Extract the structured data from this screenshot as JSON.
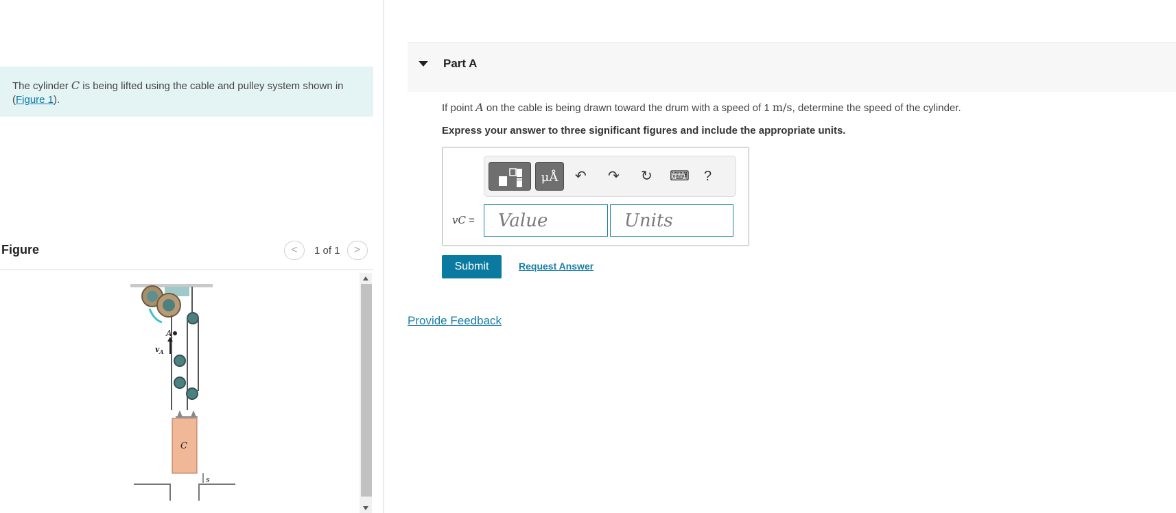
{
  "intro": {
    "text_before": "The cylinder ",
    "variable": "C",
    "text_after": " is being lifted using the cable and pulley system shown in (",
    "figure_link": "Figure 1",
    "text_end": ")."
  },
  "figure_panel": {
    "title": "Figure",
    "pager_label": "1 of 1",
    "prev_glyph": "<",
    "next_glyph": ">",
    "labels": {
      "point": "A",
      "velocity": "v",
      "velocity_sub": "A",
      "cylinder": "C",
      "distance": "s"
    }
  },
  "part": {
    "title": "Part A",
    "question_before": "If point ",
    "question_var": "A",
    "question_mid": " on the cable is being drawn toward the drum with a speed of 1 ",
    "question_unit": "m/s",
    "question_after": ", determine the speed of the cylinder.",
    "instruction": "Express your answer to three significant figures and include the appropriate units."
  },
  "answer": {
    "variable_label": "vC",
    "equals": " =",
    "value_placeholder": "Value",
    "units_placeholder": "Units",
    "toolbar": {
      "symbols_label": "μÅ",
      "undo_glyph": "↶",
      "redo_glyph": "↷",
      "reset_glyph": "↻",
      "keyboard_glyph": "⌨",
      "help_label": "?"
    }
  },
  "actions": {
    "submit_label": "Submit",
    "request_answer_label": "Request Answer",
    "feedback_label": "Provide Feedback"
  }
}
